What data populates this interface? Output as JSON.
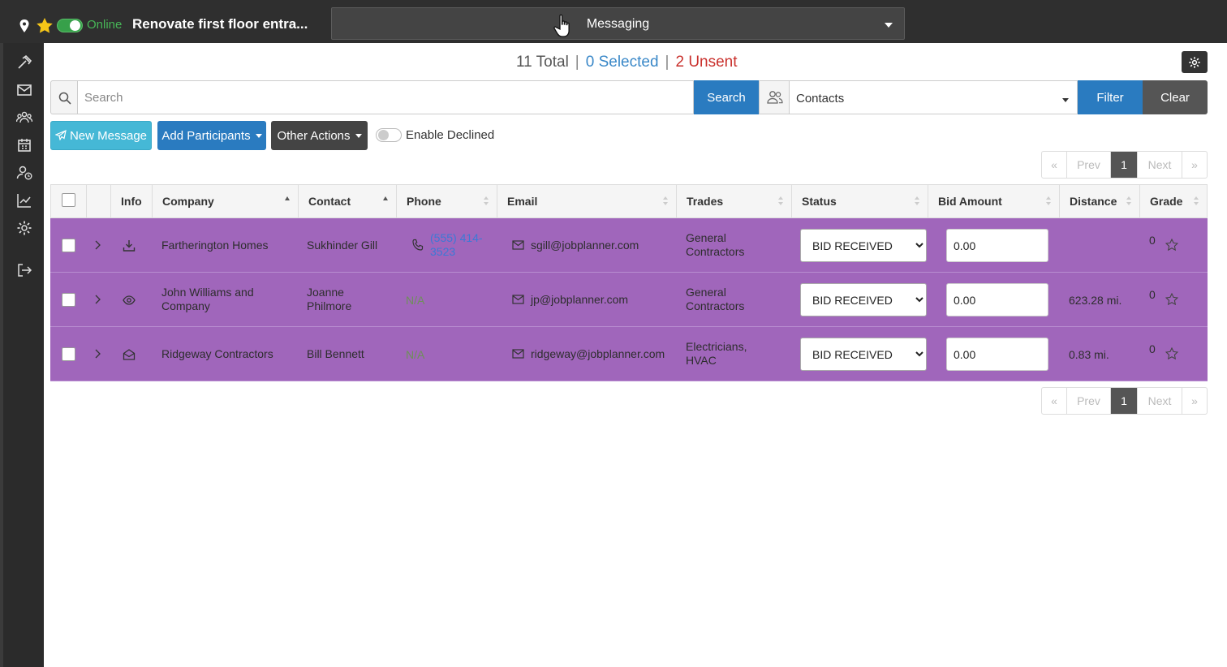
{
  "topbar": {
    "status_label": "Online",
    "project_title": "Renovate first floor entra...",
    "module": "Messaging"
  },
  "counts": {
    "total": "11 Total",
    "selected": "0 Selected",
    "unsent": "2 Unsent",
    "separator": "|"
  },
  "search": {
    "placeholder": "Search",
    "value": "",
    "button": "Search"
  },
  "filter": {
    "contacts_selected": "Contacts",
    "filter_button": "Filter",
    "clear_button": "Clear"
  },
  "actions": {
    "new_message": "New Message",
    "add_participants": "Add Participants",
    "other_actions": "Other Actions",
    "enable_declined": "Enable Declined"
  },
  "pager": {
    "first": "«",
    "prev": "Prev",
    "current": "1",
    "next": "Next",
    "last": "»"
  },
  "table": {
    "headers": {
      "info": "Info",
      "company": "Company",
      "contact": "Contact",
      "phone": "Phone",
      "email": "Email",
      "trades": "Trades",
      "status": "Status",
      "bid_amount": "Bid Amount",
      "distance": "Distance",
      "grade": "Grade"
    },
    "rows": [
      {
        "info_icon": "download-icon",
        "company": "Fartherington Homes",
        "contact": "Sukhinder Gill",
        "phone_line1": "(555) 414-",
        "phone_line2": "3523",
        "email": "sgill@jobplanner.com",
        "trades_line1": "General",
        "trades_line2": "Contractors",
        "status": "BID RECEIVED",
        "bid_amount": "0.00",
        "distance": "",
        "grade": "0"
      },
      {
        "info_icon": "eye-icon",
        "company_line1": "John Williams and",
        "company_line2": "Company",
        "contact_line1": "Joanne",
        "contact_line2": "Philmore",
        "phone": "N/A",
        "email": "jp@jobplanner.com",
        "trades_line1": "General",
        "trades_line2": "Contractors",
        "status": "BID RECEIVED",
        "bid_amount": "0.00",
        "distance": "623.28 mi.",
        "grade": "0"
      },
      {
        "info_icon": "envelope-open-icon",
        "company": "Ridgeway Contractors",
        "contact": "Bill Bennett",
        "phone": "N/A",
        "email": "ridgeway@jobplanner.com",
        "trades_line1": "Electricians,",
        "trades_line2": "HVAC",
        "status": "BID RECEIVED",
        "bid_amount": "0.00",
        "distance": "0.83 mi.",
        "grade": "0"
      }
    ]
  },
  "colors": {
    "row_highlight": "#a066bb",
    "primary": "#2a7bc0",
    "info": "#45b8d6",
    "online": "#47b657",
    "unsent": "#c9302c"
  }
}
